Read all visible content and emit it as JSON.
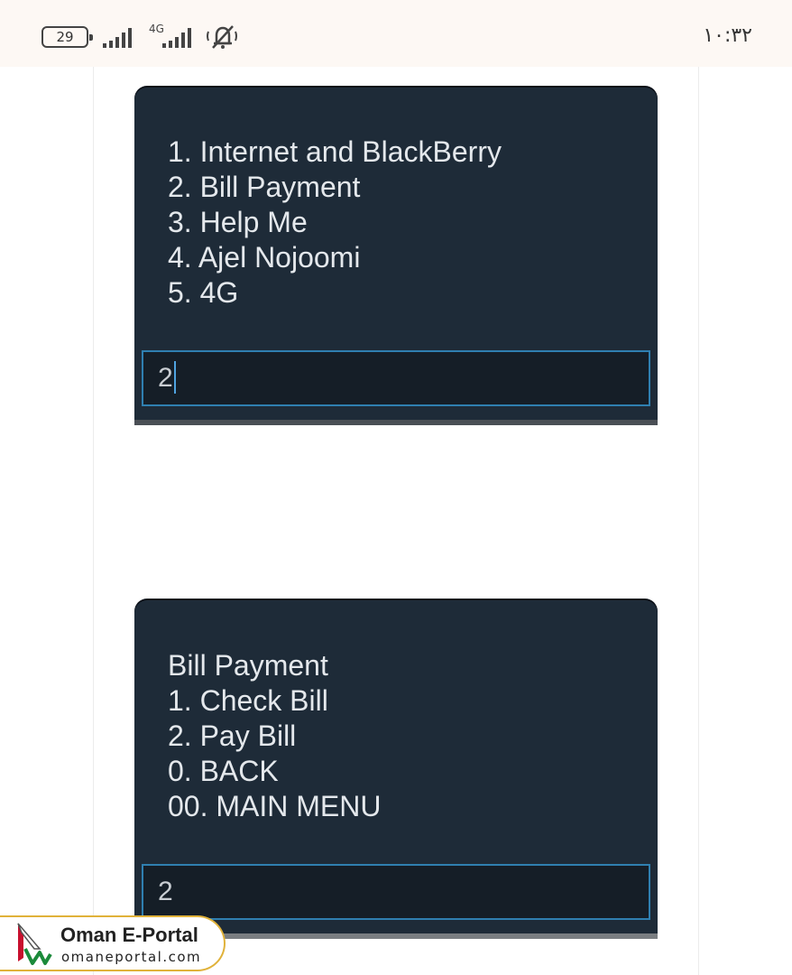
{
  "status_bar": {
    "battery": "29",
    "network": "4G",
    "clock": "١٠:٣٢"
  },
  "ussd_screens": [
    {
      "lines": [
        "1. Internet and BlackBerry",
        "2. Bill Payment",
        "3. Help Me",
        "4. Ajel Nojoomi",
        "5. 4G"
      ],
      "input_value": "2"
    },
    {
      "lines": [
        "Bill Payment",
        "1. Check Bill",
        "2. Pay Bill",
        "0. BACK",
        "00. MAIN MENU"
      ],
      "input_value": "2"
    }
  ],
  "watermark": {
    "title": "Oman E-Portal",
    "subtitle": "omaneportal.com"
  },
  "colors": {
    "dialog_bg": "#1e2b38",
    "input_border": "#2f7fb0",
    "watermark_border": "#e0b23a"
  }
}
